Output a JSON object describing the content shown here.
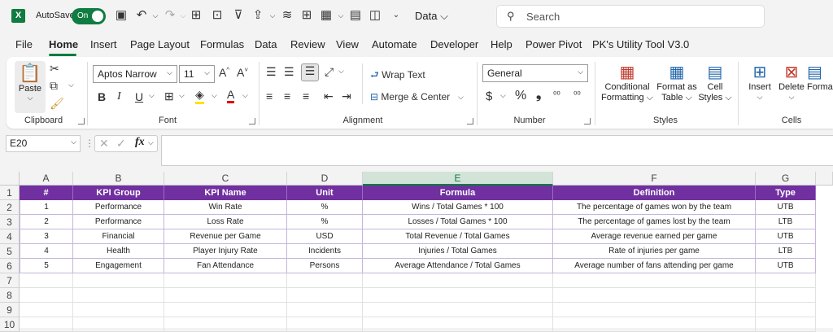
{
  "app": {
    "autosave_label": "AutoSave",
    "autosave_state": "On",
    "doc_name": "Data ⌵",
    "search_placeholder": "Search"
  },
  "menu": [
    "File",
    "Home",
    "Insert",
    "Page Layout",
    "Formulas",
    "Data",
    "Review",
    "View",
    "Automate",
    "Developer",
    "Help",
    "Power Pivot",
    "PK's Utility Tool V3.0"
  ],
  "ribbon": {
    "clipboard": {
      "paste": "Paste",
      "label": "Clipboard"
    },
    "font": {
      "name": "Aptos Narrow",
      "size": "11",
      "label": "Font",
      "bold": "B",
      "italic": "I",
      "underline": "U"
    },
    "alignment": {
      "wrap": "Wrap Text",
      "merge": "Merge & Center",
      "label": "Alignment"
    },
    "number": {
      "format": "General",
      "label": "Number",
      "currency": "$",
      "percent": "%",
      "comma": "❟"
    },
    "styles": {
      "cond1": "Conditional",
      "cond2": "Formatting ⌵",
      "fmt1": "Format as",
      "fmt2": "Table ⌵",
      "cell1": "Cell",
      "cell2": "Styles ⌵",
      "label": "Styles"
    },
    "cells": {
      "insert": "Insert",
      "delete": "Delete",
      "format": "Forma",
      "label": "Cells"
    }
  },
  "formula_bar": {
    "name_box": "E20",
    "fx": "fx",
    "content": ""
  },
  "columns": [
    "A",
    "B",
    "C",
    "D",
    "E",
    "F",
    "G"
  ],
  "rows": [
    "1",
    "2",
    "3",
    "4",
    "5",
    "6",
    "7",
    "8",
    "9",
    "10"
  ],
  "table": {
    "headers": [
      "#",
      "KPI Group",
      "KPI Name",
      "Unit",
      "Formula",
      "Definition",
      "Type"
    ],
    "rows": [
      [
        "1",
        "Performance",
        "Win Rate",
        "%",
        "Wins / Total Games * 100",
        "The percentage of games won by the team",
        "UTB"
      ],
      [
        "2",
        "Performance",
        "Loss Rate",
        "%",
        "Losses / Total Games * 100",
        "The percentage of games lost by the team",
        "LTB"
      ],
      [
        "3",
        "Financial",
        "Revenue per Game",
        "USD",
        "Total Revenue / Total Games",
        "Average revenue earned per game",
        "UTB"
      ],
      [
        "4",
        "Health",
        "Player Injury Rate",
        "Incidents",
        "Injuries / Total Games",
        "Rate of injuries per game",
        "LTB"
      ],
      [
        "5",
        "Engagement",
        "Fan Attendance",
        "Persons",
        "Average Attendance / Total Games",
        "Average number of fans attending per game",
        "UTB"
      ]
    ]
  },
  "colors": {
    "accent": "#107c41",
    "header_fill": "#7030a0"
  }
}
